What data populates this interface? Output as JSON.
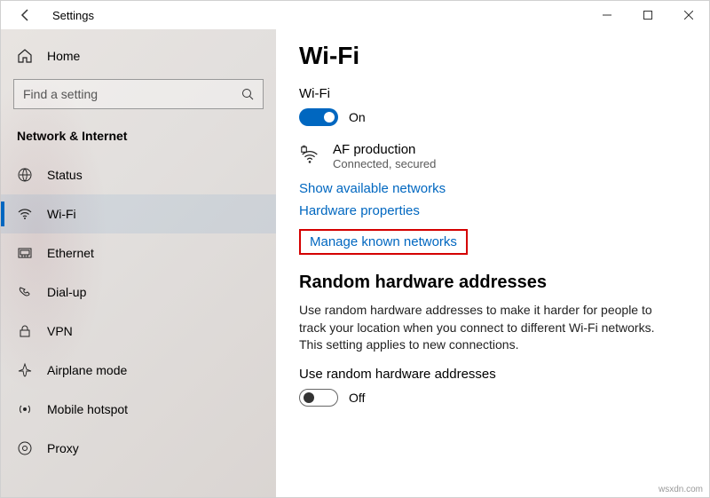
{
  "window": {
    "title": "Settings"
  },
  "sidebar": {
    "home": "Home",
    "search_placeholder": "Find a setting",
    "category": "Network & Internet",
    "items": [
      {
        "label": "Status"
      },
      {
        "label": "Wi-Fi"
      },
      {
        "label": "Ethernet"
      },
      {
        "label": "Dial-up"
      },
      {
        "label": "VPN"
      },
      {
        "label": "Airplane mode"
      },
      {
        "label": "Mobile hotspot"
      },
      {
        "label": "Proxy"
      }
    ]
  },
  "main": {
    "title": "Wi-Fi",
    "wifi": {
      "label": "Wi-Fi",
      "toggle_state": "On",
      "network_name": "AF production",
      "network_status": "Connected, secured",
      "link_available": "Show available networks",
      "link_hw": "Hardware properties",
      "link_manage": "Manage known networks"
    },
    "random": {
      "heading": "Random hardware addresses",
      "description": "Use random hardware addresses to make it harder for people to track your location when you connect to different Wi-Fi networks. This setting applies to new connections.",
      "toggle_label": "Use random hardware addresses",
      "toggle_state": "Off"
    }
  },
  "watermark": "wsxdn.com"
}
